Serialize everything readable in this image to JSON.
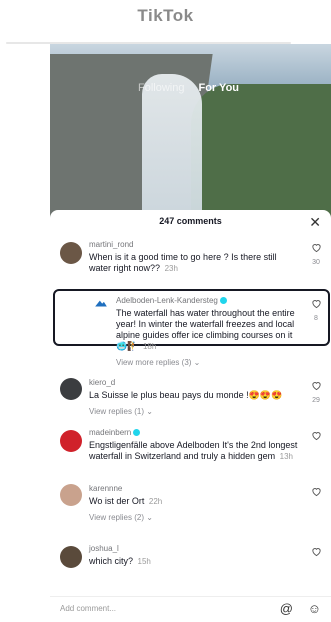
{
  "app": {
    "title": "TikTok"
  },
  "video": {
    "tabs": [
      "Following",
      "For You"
    ]
  },
  "comments_sheet": {
    "count_label": "247 comments",
    "close_icon": "close-icon",
    "comments": [
      {
        "username": "martini_rond",
        "text": "When is it a good time to go here ? Is there still water right now??",
        "time": "23h",
        "likes": "30",
        "replies": ""
      },
      {
        "username": "Adelboden-Lenk-Kandersteg",
        "text": "The waterfall has water throughout the entire year! In winter the waterfall freezes and local alpine guides offer ice climbing courses on it 🥶🧗",
        "time": "18h",
        "likes": "8",
        "replies": "View more replies (3)",
        "verified": true
      },
      {
        "username": "kiero_d",
        "text": "La Suisse le plus beau pays du monde !😍😍😍",
        "time": "",
        "likes": "29",
        "replies": "View replies (1)"
      },
      {
        "username": "madeinbern",
        "text": "Engstligenfälle above Adelboden It's the 2nd longest waterfall in Switzerland and truly a hidden gem",
        "time": "13h",
        "likes": "",
        "replies": "",
        "verified": true
      },
      {
        "username": "karennne",
        "text": "Wo ist der Ort",
        "time": "22h",
        "likes": "",
        "replies": "View replies (2)"
      },
      {
        "username": "joshua_l",
        "text": "which city?",
        "time": "15h",
        "likes": "",
        "replies": ""
      }
    ]
  },
  "bottom_bar": {
    "placeholder": "Add comment...",
    "at_icon": "at-icon",
    "emoji_icon": "emoji-icon"
  }
}
